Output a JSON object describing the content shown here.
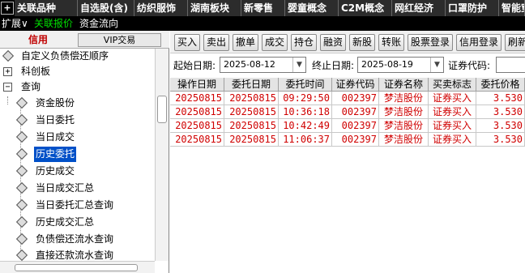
{
  "top_tabs": [
    {
      "label": "关联品种",
      "active": true
    },
    {
      "label": "自选股(含)",
      "active": false
    },
    {
      "label": "纺织服饰",
      "active": false
    },
    {
      "label": "湖南板块",
      "active": false
    },
    {
      "label": "新零售",
      "active": false
    },
    {
      "label": "婴童概念",
      "active": false
    },
    {
      "label": "C2M概念",
      "active": false
    },
    {
      "label": "网红经济",
      "active": false
    },
    {
      "label": "口罩防护",
      "active": false
    },
    {
      "label": "智能穿",
      "active": false
    }
  ],
  "sub_bar": {
    "expand": "扩展∨",
    "related_quotes": "关联报价",
    "capital_flow": "资金流向"
  },
  "left_panel": {
    "tab_credit": "信用",
    "tab_vip": "VIP交易",
    "tree": [
      {
        "label": "自定义负债偿还顺序"
      },
      {
        "label": "科创板"
      },
      {
        "label": "查询"
      },
      {
        "label": "资金股份"
      },
      {
        "label": "当日委托"
      },
      {
        "label": "当日成交"
      },
      {
        "label": "历史委托",
        "selected": true
      },
      {
        "label": "历史成交"
      },
      {
        "label": "当日成交汇总"
      },
      {
        "label": "当日委托汇总查询"
      },
      {
        "label": "历史成交汇总"
      },
      {
        "label": "负债偿还流水查询"
      },
      {
        "label": "直接还款流水查询"
      }
    ]
  },
  "toolbar": {
    "buttons": [
      "买入",
      "卖出",
      "撤单",
      "成交",
      "持仓",
      "融资",
      "新股",
      "转账",
      "股票登录",
      "信用登录",
      "刷新"
    ]
  },
  "filter": {
    "start_label": "起始日期:",
    "start_value": "2025-08-12",
    "end_label": "终止日期:",
    "end_value": "2025-08-19",
    "code_label": "证券代码:",
    "code_value": ""
  },
  "table": {
    "headers": [
      "操作日期",
      "委托日期",
      "委托时间",
      "证券代码",
      "证券名称",
      "买卖标志",
      "委托价格"
    ],
    "rows": [
      [
        "20250815",
        "20250815",
        "09:29:50",
        "002397",
        "梦洁股份",
        "证券买入",
        "3.530"
      ],
      [
        "20250815",
        "20250815",
        "10:36:18",
        "002397",
        "梦洁股份",
        "证券买入",
        "3.530"
      ],
      [
        "20250815",
        "20250815",
        "10:42:49",
        "002397",
        "梦洁股份",
        "证券买入",
        "3.530"
      ],
      [
        "20250815",
        "20250815",
        "11:06:37",
        "002397",
        "梦洁股份",
        "证券买入",
        "3.530"
      ]
    ]
  },
  "colors": {
    "active_tab": "#d40000",
    "row_text": "#d00000",
    "selected_tree": "#0050c8",
    "accent_green": "#00e000"
  }
}
